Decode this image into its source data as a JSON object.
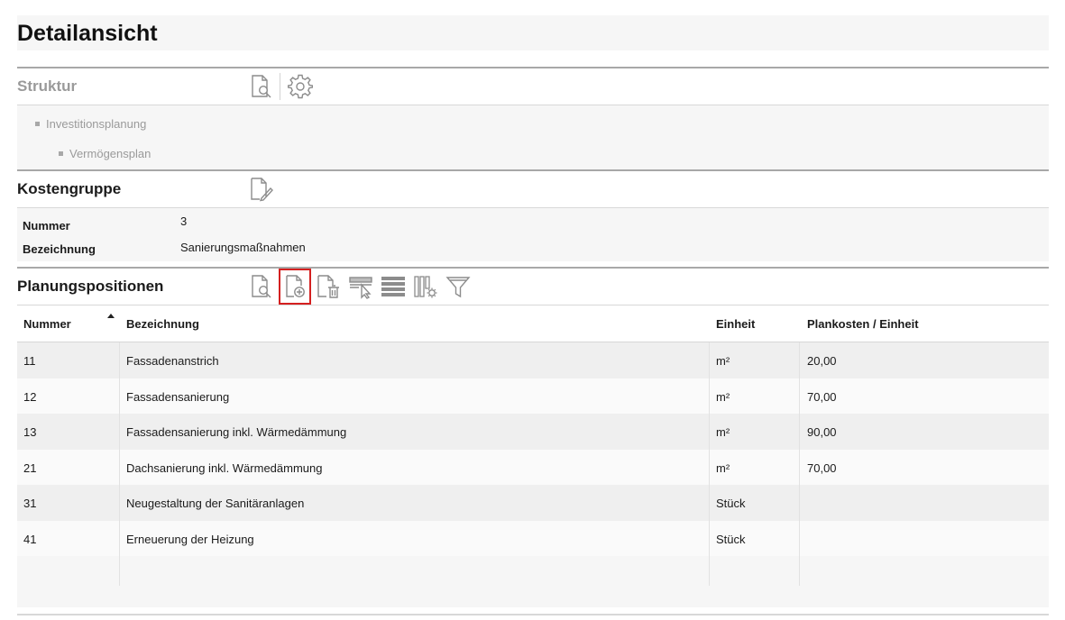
{
  "page_title": "Detailansicht",
  "struktur": {
    "label": "Struktur",
    "icons": [
      "document-search-icon",
      "gear-icon"
    ],
    "tree": [
      {
        "label": "Investitionsplanung",
        "level": 1
      },
      {
        "label": "Vermögensplan",
        "level": 2
      }
    ]
  },
  "kostengruppe": {
    "label": "Kostengruppe",
    "icons": [
      "document-edit-icon"
    ],
    "fields": [
      {
        "key": "Nummer",
        "value": "3"
      },
      {
        "key": "Bezeichnung",
        "value": "Sanierungsmaßnahmen"
      }
    ]
  },
  "planungspositionen": {
    "label": "Planungspositionen",
    "icons": [
      "document-search-icon",
      "document-add-icon",
      "document-delete-icon",
      "column-select-icon",
      "rows-icon",
      "column-settings-icon",
      "filter-icon"
    ],
    "selected_icon": "document-add-icon",
    "columns": [
      "Nummer",
      "Bezeichnung",
      "Einheit",
      "Plankosten / Einheit"
    ],
    "sort": {
      "column": "Nummer",
      "direction": "asc"
    },
    "rows": [
      {
        "nummer": "11",
        "bezeichnung": "Fassadenanstrich",
        "einheit": "m²",
        "plankosten": "20,00"
      },
      {
        "nummer": "12",
        "bezeichnung": "Fassadensanierung",
        "einheit": "m²",
        "plankosten": "70,00"
      },
      {
        "nummer": "13",
        "bezeichnung": "Fassadensanierung inkl. Wärmedämmung",
        "einheit": "m²",
        "plankosten": "90,00"
      },
      {
        "nummer": "21",
        "bezeichnung": "Dachsanierung inkl. Wärmedämmung",
        "einheit": "m²",
        "plankosten": "70,00"
      },
      {
        "nummer": "31",
        "bezeichnung": "Neugestaltung der Sanitäranlagen",
        "einheit": "Stück",
        "plankosten": ""
      },
      {
        "nummer": "41",
        "bezeichnung": "Erneuerung der Heizung",
        "einheit": "Stück",
        "plankosten": ""
      }
    ]
  },
  "colors": {
    "selection_outline": "#d42020",
    "section_line": "#a8a8a8",
    "muted_text": "#9a9a9a",
    "icon_gray": "#8c8c8c"
  }
}
